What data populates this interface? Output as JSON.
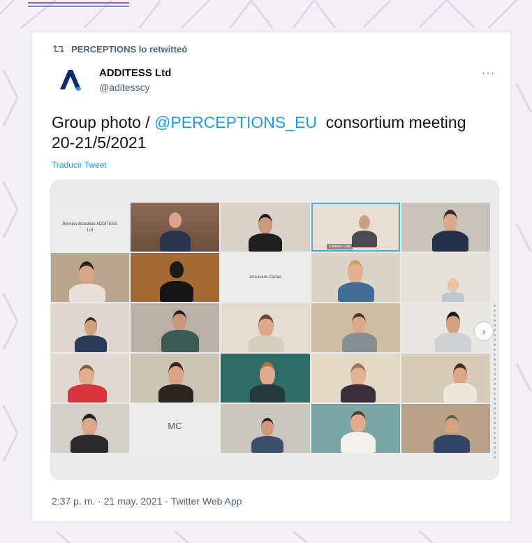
{
  "retweet": {
    "label": "PERCEPTIONS lo retwitteó"
  },
  "author": {
    "name": "ADDITESS Ltd",
    "handle": "@aditesscy"
  },
  "more_label": "···",
  "tweet": {
    "text_before": "Group photo / ",
    "mention": "@PERCEPTIONS_EU",
    "text_after": "  consortium meeting 20-21/5/2021",
    "translate_label": "Traducir Tweet"
  },
  "photo": {
    "tile_1_label": "Boreios Bratsikas ADDITESS",
    "tile_1_sub": "Ltd",
    "tile_3_caption": "Collabito Cafe",
    "tile_8_label": "Ana Louis Carias",
    "tile_22_initials": "MC",
    "next_label": "›"
  },
  "timestamp": {
    "time": "2:37 p. m.",
    "sep1": " · ",
    "date": "21 may. 2021",
    "sep2": " · ",
    "source": "Twitter Web App"
  },
  "colors": {
    "accent": "#1d9bf0",
    "logo": "#0b2a6f",
    "logo_accent": "#1d9bf0"
  }
}
